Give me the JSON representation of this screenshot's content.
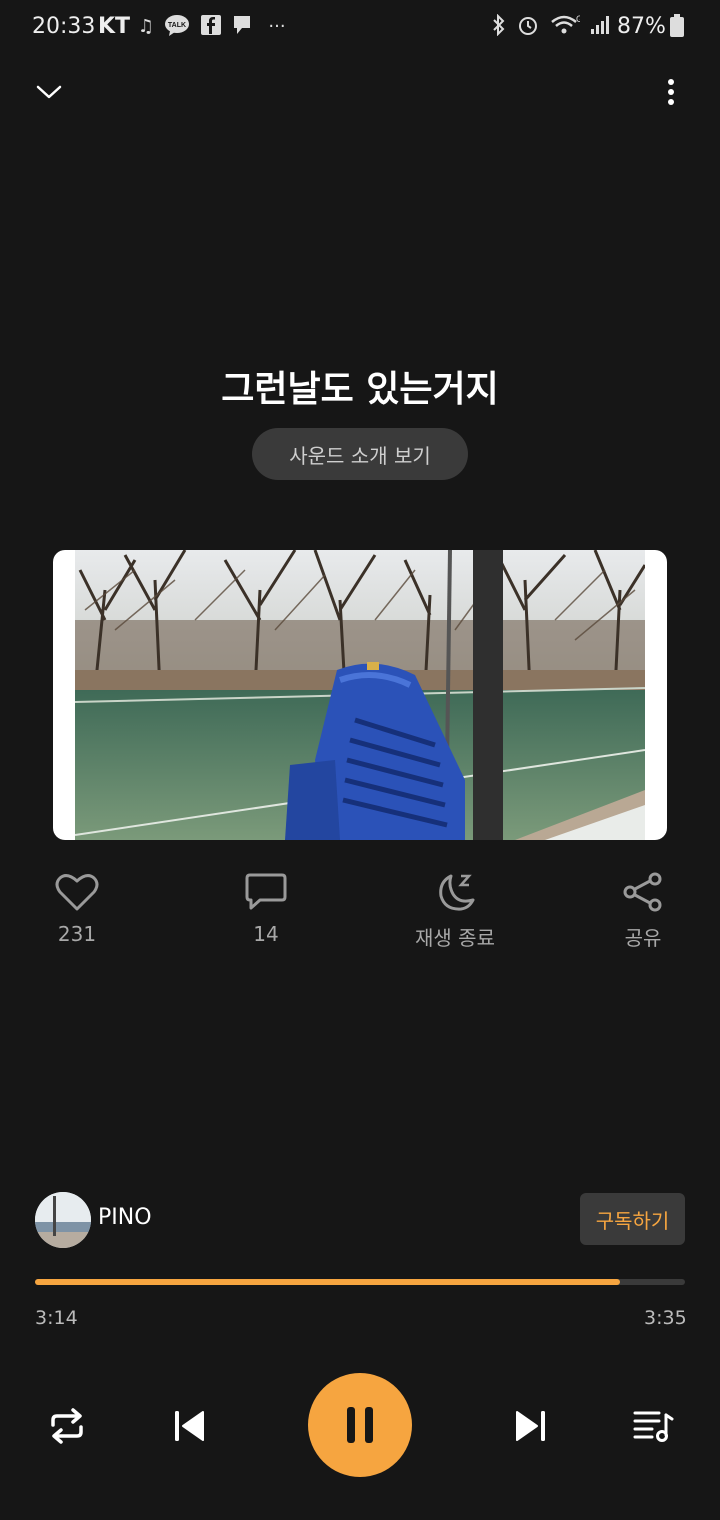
{
  "status_bar": {
    "time": "20:33",
    "carrier": "KT",
    "battery": "87%",
    "icons": [
      "music-icon",
      "kakaotalk-icon",
      "facebook-icon",
      "chat-icon",
      "more-dots-icon",
      "bluetooth-icon",
      "alarm-icon",
      "wifi-icon",
      "signal-icon",
      "battery-icon"
    ]
  },
  "header": {
    "collapse_icon": "chevron-down-icon",
    "menu_icon": "more-vertical-icon"
  },
  "track": {
    "title": "그런날도 있는거지",
    "sound_intro_label": "사운드 소개 보기"
  },
  "actions": {
    "likes": "231",
    "comments": "14",
    "sleep_timer_label": "재생 종료",
    "share_label": "공유"
  },
  "channel": {
    "name": "PINO",
    "subscribe_label": "구독하기"
  },
  "playback": {
    "current_time": "3:14",
    "total_time": "3:35",
    "progress": 0.9
  },
  "colors": {
    "background": "#161616",
    "accent": "#f6a540",
    "button_bg": "#3a3a3a"
  }
}
